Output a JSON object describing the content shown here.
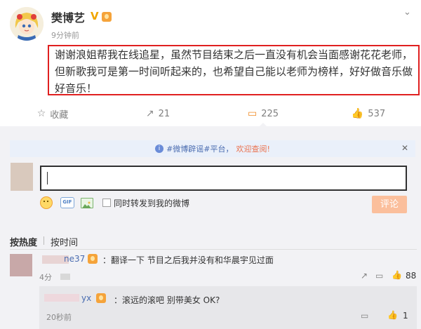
{
  "post": {
    "username": "樊博艺",
    "verified_mark": "V",
    "timestamp": "9分钟前",
    "text": "谢谢浪姐帮我在线追星，虽然节目结束之后一直没有机会当面感谢花花老师，但新歌我可是第一时间听起来的，也希望自己能以老师为榜样，好好做音乐做好音乐！",
    "more_icon": "chevron-down-icon"
  },
  "actions": {
    "favorite": {
      "label": "收藏",
      "icon": "star-icon"
    },
    "repost": {
      "count": "21",
      "icon": "share-icon"
    },
    "comment": {
      "count": "225",
      "icon": "comment-icon"
    },
    "like": {
      "count": "537",
      "icon": "thumbs-up-icon"
    }
  },
  "notice": {
    "info_icon_glyph": "i",
    "tag": "#微博辟谣#平台，",
    "link": "欢迎查阅!",
    "close_glyph": "✕"
  },
  "composer": {
    "gif_label": "GIF",
    "repost_checkbox_label": "同时转发到我的微博",
    "submit_label": "评论"
  },
  "sort": {
    "hot": "按热度",
    "time": "按时间"
  },
  "comments": [
    {
      "name_suffix": "ne37",
      "text": "：翻译一下 节目之后我并没有和华晨宇见过面",
      "time": "4分",
      "likes": "88"
    }
  ],
  "reply": {
    "name_suffix": "yx",
    "text": "：滚远的滚吧 别带美女 OK?",
    "time": "20秒前",
    "likes": "1"
  },
  "colors": {
    "accent_orange": "#f08a24",
    "highlight_red": "#e02020",
    "link_blue": "#4a6cb0",
    "submit_disabled": "#fbbf9c"
  }
}
